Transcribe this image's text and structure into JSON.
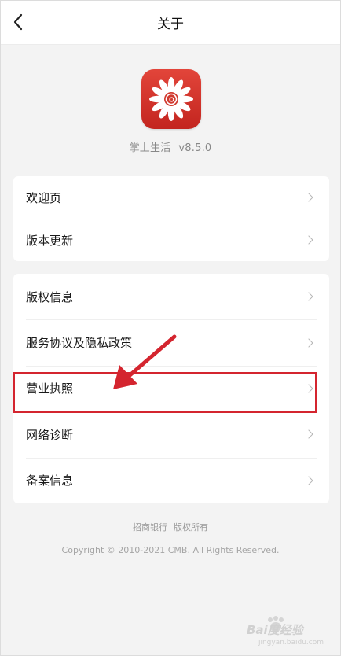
{
  "header": {
    "title": "关于"
  },
  "app": {
    "name": "掌上生活",
    "version": "v8.5.0"
  },
  "menu_group_1": [
    {
      "label": "欢迎页"
    },
    {
      "label": "版本更新"
    }
  ],
  "menu_group_2": [
    {
      "label": "版权信息"
    },
    {
      "label": "服务协议及隐私政策"
    },
    {
      "label": "营业执照"
    },
    {
      "label": "网络诊断"
    },
    {
      "label": "备案信息"
    }
  ],
  "footer": {
    "owner_bank": "招商银行",
    "owner_rights": "版权所有",
    "copyright": "Copyright © 2010-2021 CMB. All Rights Reserved."
  },
  "watermark": {
    "brand": "Bai度经验",
    "url": "jingyan.baidu.com"
  },
  "colors": {
    "logo_red": "#d13a2f",
    "annotation_red": "#d4252f",
    "background": "#f3f3f3"
  }
}
